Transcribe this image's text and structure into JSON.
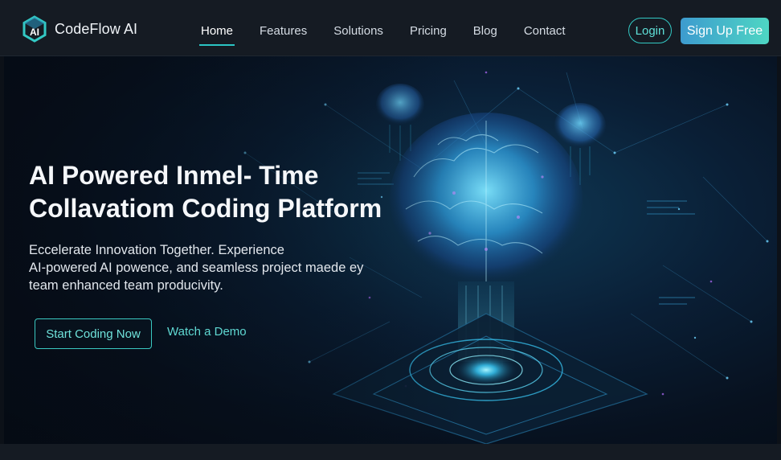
{
  "brand": {
    "name": "CodeFlow AI",
    "logo_icon": "hex-ai-logo-icon"
  },
  "nav": {
    "items": [
      {
        "label": "Home",
        "active": true
      },
      {
        "label": "Features",
        "active": false
      },
      {
        "label": "Solutions",
        "active": false
      },
      {
        "label": "Pricing",
        "active": false
      },
      {
        "label": "Blog",
        "active": false
      },
      {
        "label": "Contact",
        "active": false
      }
    ],
    "login_label": "Login",
    "signup_label": "Sign Up Free"
  },
  "hero": {
    "title_line1": "AI Powered Inmel- Time",
    "title_line2": "Collavatiom Coding Platform",
    "sub_line1": "Eccelerate Innovation Together. Experience",
    "sub_line2": "AI-powered AI powence, and seamless project maede ey",
    "sub_line3": "team enhanced team producivity.",
    "primary_cta": "Start Coding Now",
    "secondary_cta": "Watch a Demo",
    "illustration": "glowing-brain-network-illustration"
  },
  "colors": {
    "accent": "#33c9c4",
    "header_bg": "#151b23",
    "hero_glow": "#3fb8ff",
    "purple_glow": "#b46cff"
  }
}
